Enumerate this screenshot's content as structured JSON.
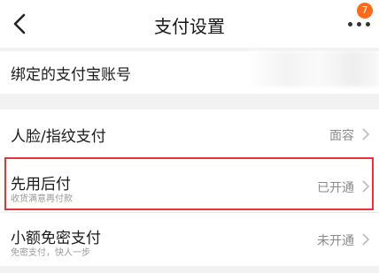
{
  "header": {
    "title": "支付设置",
    "badge_count": "7"
  },
  "rows": {
    "alipay": {
      "label": "绑定的支付宝账号"
    },
    "face": {
      "label": "人脸/指纹支付",
      "value": "面容"
    },
    "pay_later": {
      "label": "先用后付",
      "sub": "收货满意再付款",
      "value": "已开通"
    },
    "small": {
      "label": "小额免密支付",
      "sub": "免密支付，快人一步",
      "value": "未开通"
    }
  },
  "colors": {
    "highlight": "#e0353d",
    "badge": "#ff6a1a"
  }
}
